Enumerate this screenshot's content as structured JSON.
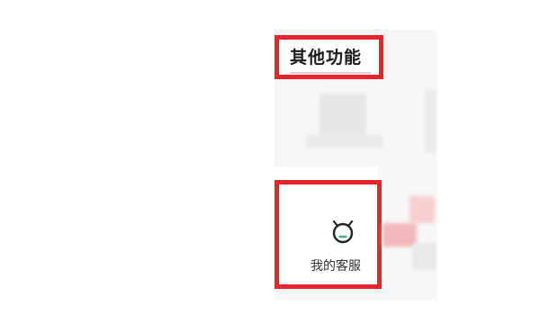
{
  "section": {
    "title": "其他功能"
  },
  "service_tile": {
    "label": "我的客服",
    "icon": "customer-service-icon"
  },
  "colors": {
    "annotation_red": "#e8242c",
    "icon_dark": "#222222",
    "icon_accent": "#4caf8a"
  }
}
